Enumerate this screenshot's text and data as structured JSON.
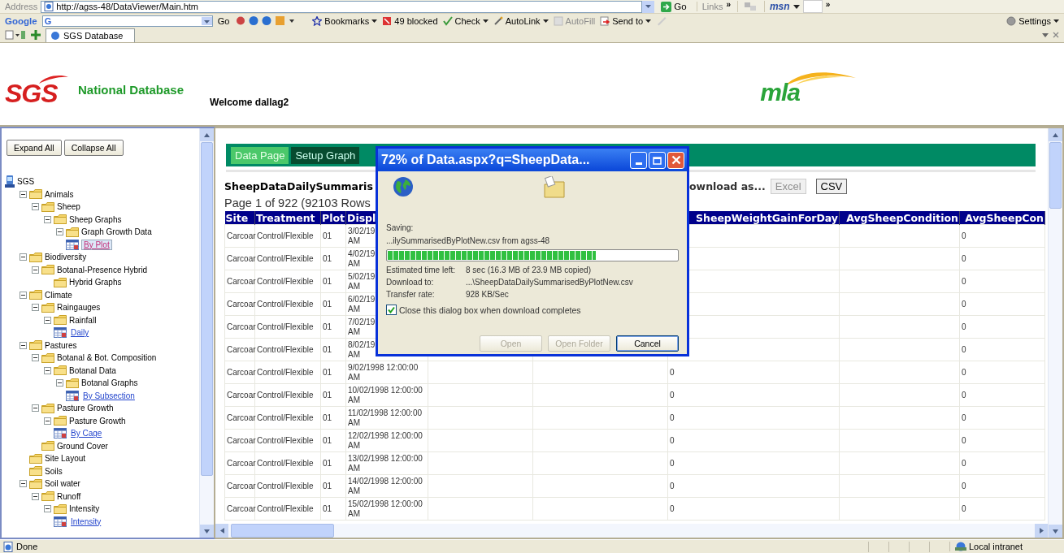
{
  "browser": {
    "address_label": "Address",
    "url": "http://agss-48/DataViewer/Main.htm",
    "go": "Go",
    "links": "Links",
    "links_more": "»",
    "msn": "msn",
    "toolbar_more": "»"
  },
  "google_toolbar": {
    "logo": "Google",
    "search_prefix": "G",
    "go": "Go",
    "settings": "Settings",
    "buttons": [
      {
        "label": "Bookmarks",
        "kind": "star",
        "dropdown": true,
        "disabled": false
      },
      {
        "label": "49 blocked",
        "kind": "block",
        "dropdown": false,
        "disabled": false
      },
      {
        "label": "Check",
        "kind": "check",
        "dropdown": true,
        "disabled": false
      },
      {
        "label": "AutoLink",
        "kind": "autolink",
        "dropdown": true,
        "disabled": false
      },
      {
        "label": "AutoFill",
        "kind": "autofill",
        "dropdown": false,
        "disabled": true
      },
      {
        "label": "Send to",
        "kind": "sendto",
        "dropdown": true,
        "disabled": false
      }
    ]
  },
  "tab": {
    "title": "SGS Database"
  },
  "header": {
    "logo": "SGS",
    "title": "National Database",
    "welcome": "Welcome dallag2",
    "partner_logo": "mla"
  },
  "sidebar": {
    "buttons": [
      "Expand All",
      "Collapse All"
    ],
    "tree": {
      "label": "SGS",
      "kind": "root",
      "children": [
        {
          "label": "Animals",
          "kind": "folder",
          "expanded": true,
          "children": [
            {
              "label": "Sheep",
              "kind": "folder",
              "expanded": true,
              "children": [
                {
                  "label": "Sheep Graphs",
                  "kind": "folder",
                  "expanded": true,
                  "children": [
                    {
                      "label": "Graph Growth Data",
                      "kind": "folder",
                      "expanded": true,
                      "children": [
                        {
                          "label": "By Plot",
                          "kind": "report",
                          "selected": true
                        }
                      ]
                    }
                  ]
                }
              ]
            }
          ]
        },
        {
          "label": "Biodiversity",
          "kind": "folder",
          "expanded": true,
          "children": [
            {
              "label": "Botanal-Presence Hybrid",
              "kind": "folder",
              "expanded": true,
              "children": [
                {
                  "label": "Hybrid Graphs",
                  "kind": "leaf_folder"
                }
              ]
            }
          ]
        },
        {
          "label": "Climate",
          "kind": "folder",
          "expanded": true,
          "children": [
            {
              "label": "Raingauges",
              "kind": "folder",
              "expanded": true,
              "children": [
                {
                  "label": "Rainfall",
                  "kind": "folder",
                  "expanded": true,
                  "children": [
                    {
                      "label": "Daily",
                      "kind": "report",
                      "selected": false
                    }
                  ]
                }
              ]
            }
          ]
        },
        {
          "label": "Pastures",
          "kind": "folder",
          "expanded": true,
          "children": [
            {
              "label": "Botanal & Bot. Composition",
              "kind": "folder",
              "expanded": true,
              "children": [
                {
                  "label": "Botanal Data",
                  "kind": "folder",
                  "expanded": true,
                  "children": [
                    {
                      "label": "Botanal Graphs",
                      "kind": "folder",
                      "expanded": true,
                      "children": [
                        {
                          "label": "By Subsection",
                          "kind": "report",
                          "selected": false
                        }
                      ]
                    }
                  ]
                }
              ]
            },
            {
              "label": "Pasture Growth",
              "kind": "folder",
              "expanded": true,
              "children": [
                {
                  "label": "Pasture Growth",
                  "kind": "folder",
                  "expanded": true,
                  "children": [
                    {
                      "label": "By Cage",
                      "kind": "report",
                      "selected": false
                    }
                  ]
                }
              ]
            },
            {
              "label": "Ground Cover",
              "kind": "leaf_folder"
            }
          ]
        },
        {
          "label": "Site Layout",
          "kind": "leaf_folder"
        },
        {
          "label": "Soils",
          "kind": "leaf_folder"
        },
        {
          "label": "Soil water",
          "kind": "folder",
          "expanded": true,
          "children": [
            {
              "label": "Runoff",
              "kind": "folder",
              "expanded": true,
              "children": [
                {
                  "label": "Intensity",
                  "kind": "folder",
                  "expanded": true,
                  "children": [
                    {
                      "label": "Intensity",
                      "kind": "report",
                      "selected": false
                    }
                  ]
                }
              ]
            }
          ]
        }
      ]
    }
  },
  "content": {
    "tabs": [
      {
        "label": "Data Page",
        "selected": true
      },
      {
        "label": "Setup Graph",
        "selected": false
      }
    ],
    "title": "SheepDataDailySummaris",
    "page_info": "Page 1 of 922 (92103 Rows",
    "download_label": "ownload as...",
    "download_buttons": [
      {
        "label": "Excel",
        "disabled": true
      },
      {
        "label": "CSV",
        "disabled": false
      }
    ],
    "table": {
      "columns": [
        "Site",
        "Treatment",
        "Plot",
        "Displ",
        null,
        null,
        "SheepWeightGainForDay",
        "AvgSheepCondition",
        "AvgSheepCon"
      ],
      "rows": [
        [
          "Carcoar",
          "Control/Flexible",
          "01",
          "3/02/19\nAM",
          null,
          null,
          null,
          null,
          "0"
        ],
        [
          "Carcoar",
          "Control/Flexible",
          "01",
          "4/02/19\nAM",
          null,
          null,
          null,
          null,
          "0"
        ],
        [
          "Carcoar",
          "Control/Flexible",
          "01",
          "5/02/19\nAM",
          null,
          null,
          null,
          null,
          "0"
        ],
        [
          "Carcoar",
          "Control/Flexible",
          "01",
          "6/02/19\nAM",
          null,
          null,
          null,
          null,
          "0"
        ],
        [
          "Carcoar",
          "Control/Flexible",
          "01",
          "7/02/19\nAM",
          null,
          null,
          null,
          null,
          "0"
        ],
        [
          "Carcoar",
          "Control/Flexible",
          "01",
          "8/02/19\nAM",
          null,
          null,
          null,
          null,
          "0"
        ],
        [
          "Carcoar",
          "Control/Flexible",
          "01",
          "9/02/1998 12:00:00 AM",
          null,
          null,
          "0",
          null,
          "0"
        ],
        [
          "Carcoar",
          "Control/Flexible",
          "01",
          "10/02/1998 12:00:00 AM",
          null,
          null,
          "0",
          null,
          "0"
        ],
        [
          "Carcoar",
          "Control/Flexible",
          "01",
          "11/02/1998 12:00:00 AM",
          null,
          null,
          "0",
          null,
          "0"
        ],
        [
          "Carcoar",
          "Control/Flexible",
          "01",
          "12/02/1998 12:00:00 AM",
          null,
          null,
          "0",
          null,
          "0"
        ],
        [
          "Carcoar",
          "Control/Flexible",
          "01",
          "13/02/1998 12:00:00 AM",
          null,
          null,
          "0",
          null,
          "0"
        ],
        [
          "Carcoar",
          "Control/Flexible",
          "01",
          "14/02/1998 12:00:00 AM",
          null,
          null,
          "0",
          null,
          "0"
        ],
        [
          "Carcoar",
          "Control/Flexible",
          "01",
          "15/02/1998 12:00:00 AM",
          null,
          null,
          "0",
          null,
          "0"
        ]
      ]
    }
  },
  "dialog": {
    "title": "72% of Data.aspx?q=SheepData...",
    "saving_label": "Saving:",
    "file": "...ilySummarisedByPlotNew.csv from agss-48",
    "level": 0.72,
    "details": [
      {
        "label": "Estimated time left:",
        "value": "8 sec (16.3 MB of 23.9 MB copied)"
      },
      {
        "label": "Download to:",
        "value": "...\\SheepDataDailySummarisedByPlotNew.csv"
      },
      {
        "label": "Transfer rate:",
        "value": "928 KB/Sec"
      }
    ],
    "checkbox": {
      "label": "Close this dialog box when download completes",
      "checked": true
    },
    "buttons": [
      {
        "label": "Open",
        "disabled": true
      },
      {
        "label": "Open Folder",
        "disabled": true
      },
      {
        "label": "Cancel",
        "disabled": false
      }
    ]
  },
  "status_bar": {
    "text": "Done",
    "zone": "Local intranet"
  }
}
